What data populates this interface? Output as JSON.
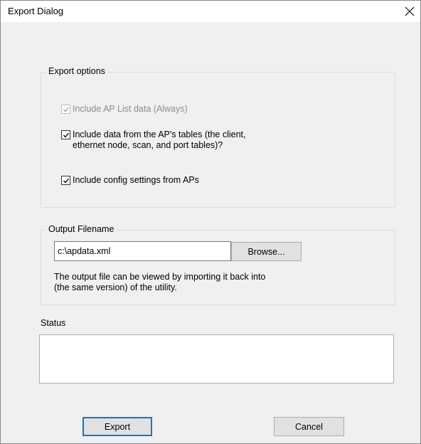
{
  "window": {
    "title": "Export Dialog",
    "close_icon": "close-icon"
  },
  "export_options": {
    "legend": "Export options",
    "options": [
      {
        "label": "Include AP List data (Always)",
        "checked": true,
        "disabled": true
      },
      {
        "label_line1": "Include data from the AP's tables (the client,",
        "label_line2": "ethernet node, scan, and port tables)?",
        "checked": true,
        "disabled": false
      },
      {
        "label": "Include config settings from APs",
        "checked": true,
        "disabled": false
      }
    ]
  },
  "output": {
    "legend": "Output Filename",
    "filename_value": "c:\\apdata.xml",
    "browse_label": "Browse...",
    "info_line1": "The output file can be viewed by importing it back into",
    "info_line2": "(the same version) of the utility."
  },
  "status": {
    "label": "Status",
    "value": ""
  },
  "buttons": {
    "export_label": "Export",
    "cancel_label": "Cancel"
  }
}
